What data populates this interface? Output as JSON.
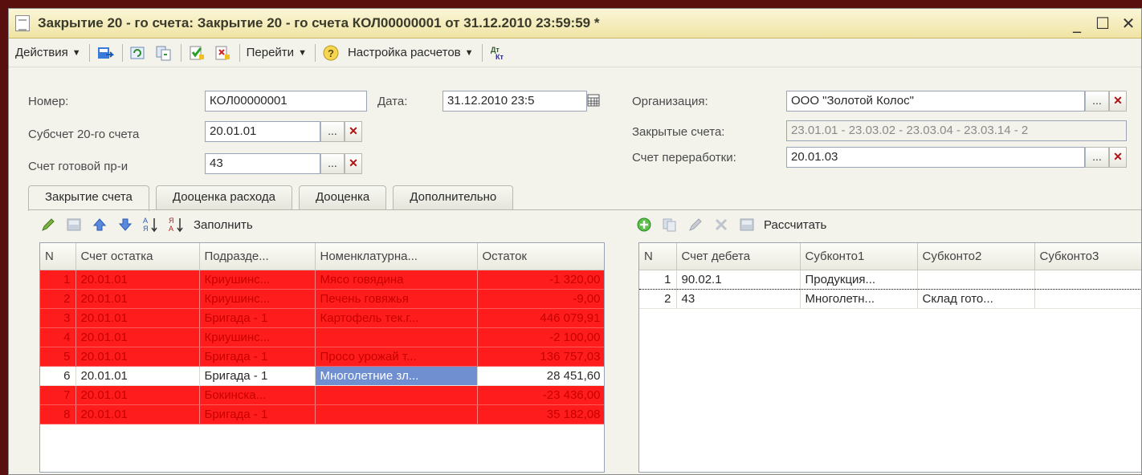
{
  "window": {
    "title": "Закрытие 20 - го счета: Закрытие 20 - го счета КОЛ00000001 от 31.12.2010 23:59:59 *",
    "minimize": "_",
    "maximize": "☐",
    "close": "✕"
  },
  "toolbar": {
    "actions_label": "Действия",
    "goto_label": "Перейти",
    "help_icon": "?",
    "settings_label": "Настройка расчетов",
    "dtkt_icon": "Дт Кт"
  },
  "form": {
    "number_label": "Номер:",
    "number_value": "КОЛ00000001",
    "date_label": "Дата:",
    "date_value": "31.12.2010 23:5",
    "org_label": "Организация:",
    "org_value": "ООО \"Золотой Колос\"",
    "subaccount_label": "Субсчет 20-го счета",
    "subaccount_value": "20.01.01",
    "closed_label": "Закрытые счета:",
    "closed_value": "23.01.01 - 23.03.02 - 23.03.04 - 23.03.14 - 2",
    "finished_label": "Счет готовой пр-и",
    "finished_value": "43",
    "processing_label": "Счет переработки:",
    "processing_value": "20.01.03",
    "select_btn": "...",
    "clear_btn": "✕"
  },
  "tabs": [
    "Закрытие счета",
    "Дооценка расхода",
    "Дооценка",
    "Дополнительно"
  ],
  "left_toolbar": {
    "fill_label": "Заполнить"
  },
  "right_toolbar": {
    "calc_label": "Рассчитать"
  },
  "left_table": {
    "columns": [
      "N",
      "Счет остатка",
      "Подразде...",
      "Номенклатурна...",
      "Остаток"
    ],
    "rows": [
      {
        "n": "1",
        "account": "20.01.01",
        "dept": "Криушинс...",
        "item": "Мясо говядина",
        "balance": "-1 320,00",
        "highlight": true
      },
      {
        "n": "2",
        "account": "20.01.01",
        "dept": "Криушинс...",
        "item": "Печень говяжья",
        "balance": "-9,00",
        "highlight": true
      },
      {
        "n": "3",
        "account": "20.01.01",
        "dept": "Бригада - 1",
        "item": "Картофель тек.г...",
        "balance": "446 079,91",
        "highlight": true
      },
      {
        "n": "4",
        "account": "20.01.01",
        "dept": "Криушинс...",
        "item": "",
        "balance": "-2 100,00",
        "highlight": true
      },
      {
        "n": "5",
        "account": "20.01.01",
        "dept": "Бригада - 1",
        "item": "Просо урожай т...",
        "balance": "136 757,03",
        "highlight": true
      },
      {
        "n": "6",
        "account": "20.01.01",
        "dept": "Бригада - 1",
        "item": "Многолетние зл...",
        "balance": "28 451,60",
        "highlight": false
      },
      {
        "n": "7",
        "account": "20.01.01",
        "dept": "Бокинска...",
        "item": "",
        "balance": "-23 436,00",
        "highlight": true
      },
      {
        "n": "8",
        "account": "20.01.01",
        "dept": "Бригада - 1",
        "item": "",
        "balance": "35 182,08",
        "highlight": true
      }
    ]
  },
  "right_table": {
    "columns": [
      "N",
      "Счет дебета",
      "Субконто1",
      "Субконто2",
      "Субконто3"
    ],
    "rows": [
      {
        "n": "1",
        "account": "90.02.1",
        "sub1": "Продукция...",
        "sub2": "",
        "sub3": ""
      },
      {
        "n": "2",
        "account": "43",
        "sub1": "Многолетн...",
        "sub2": "Склад гото...",
        "sub3": ""
      }
    ]
  },
  "colors": {
    "highlight_row": "#ff1c1c",
    "selected_cell": "#6f8fd0",
    "title_bar": "#efe4a4"
  }
}
